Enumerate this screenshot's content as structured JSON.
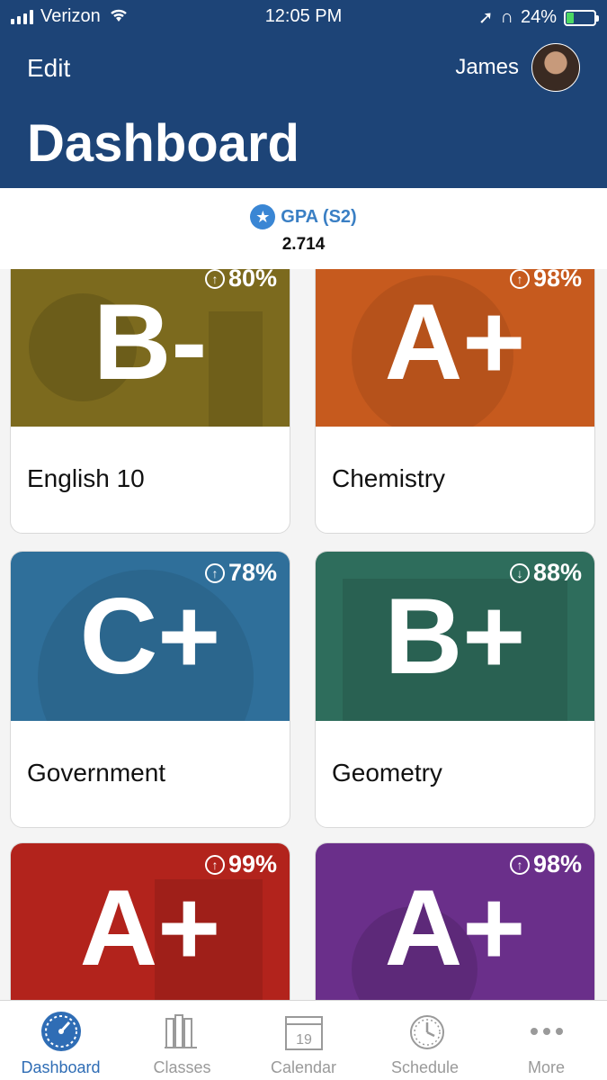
{
  "status_bar": {
    "carrier": "Verizon",
    "time": "12:05 PM",
    "battery": "24%",
    "battery_level": 0.24
  },
  "header": {
    "edit_label": "Edit",
    "user_name": "James",
    "title": "Dashboard"
  },
  "gpa": {
    "label": "GPA (S2)",
    "value": "2.714"
  },
  "courses": [
    {
      "name": "English 10",
      "grade": "B-",
      "percent": "80%",
      "trend": "up",
      "color": "#7c6a1e"
    },
    {
      "name": "Chemistry",
      "grade": "A+",
      "percent": "98%",
      "trend": "up",
      "color": "#c65a1e"
    },
    {
      "name": "Government",
      "grade": "C+",
      "percent": "78%",
      "trend": "up",
      "color": "#2f6f9a"
    },
    {
      "name": "Geometry",
      "grade": "B+",
      "percent": "88%",
      "trend": "down",
      "color": "#2e6d5c"
    },
    {
      "name": "",
      "grade": "A+",
      "percent": "99%",
      "trend": "up",
      "color": "#b2231c"
    },
    {
      "name": "",
      "grade": "A+",
      "percent": "98%",
      "trend": "up",
      "color": "#6a2f8a"
    }
  ],
  "tabs": [
    {
      "label": "Dashboard",
      "icon": "gauge-icon",
      "active": true
    },
    {
      "label": "Classes",
      "icon": "books-icon",
      "active": false
    },
    {
      "label": "Calendar",
      "icon": "calendar-icon",
      "active": false,
      "day": "19"
    },
    {
      "label": "Schedule",
      "icon": "clock-icon",
      "active": false
    },
    {
      "label": "More",
      "icon": "more-icon",
      "active": false
    }
  ]
}
